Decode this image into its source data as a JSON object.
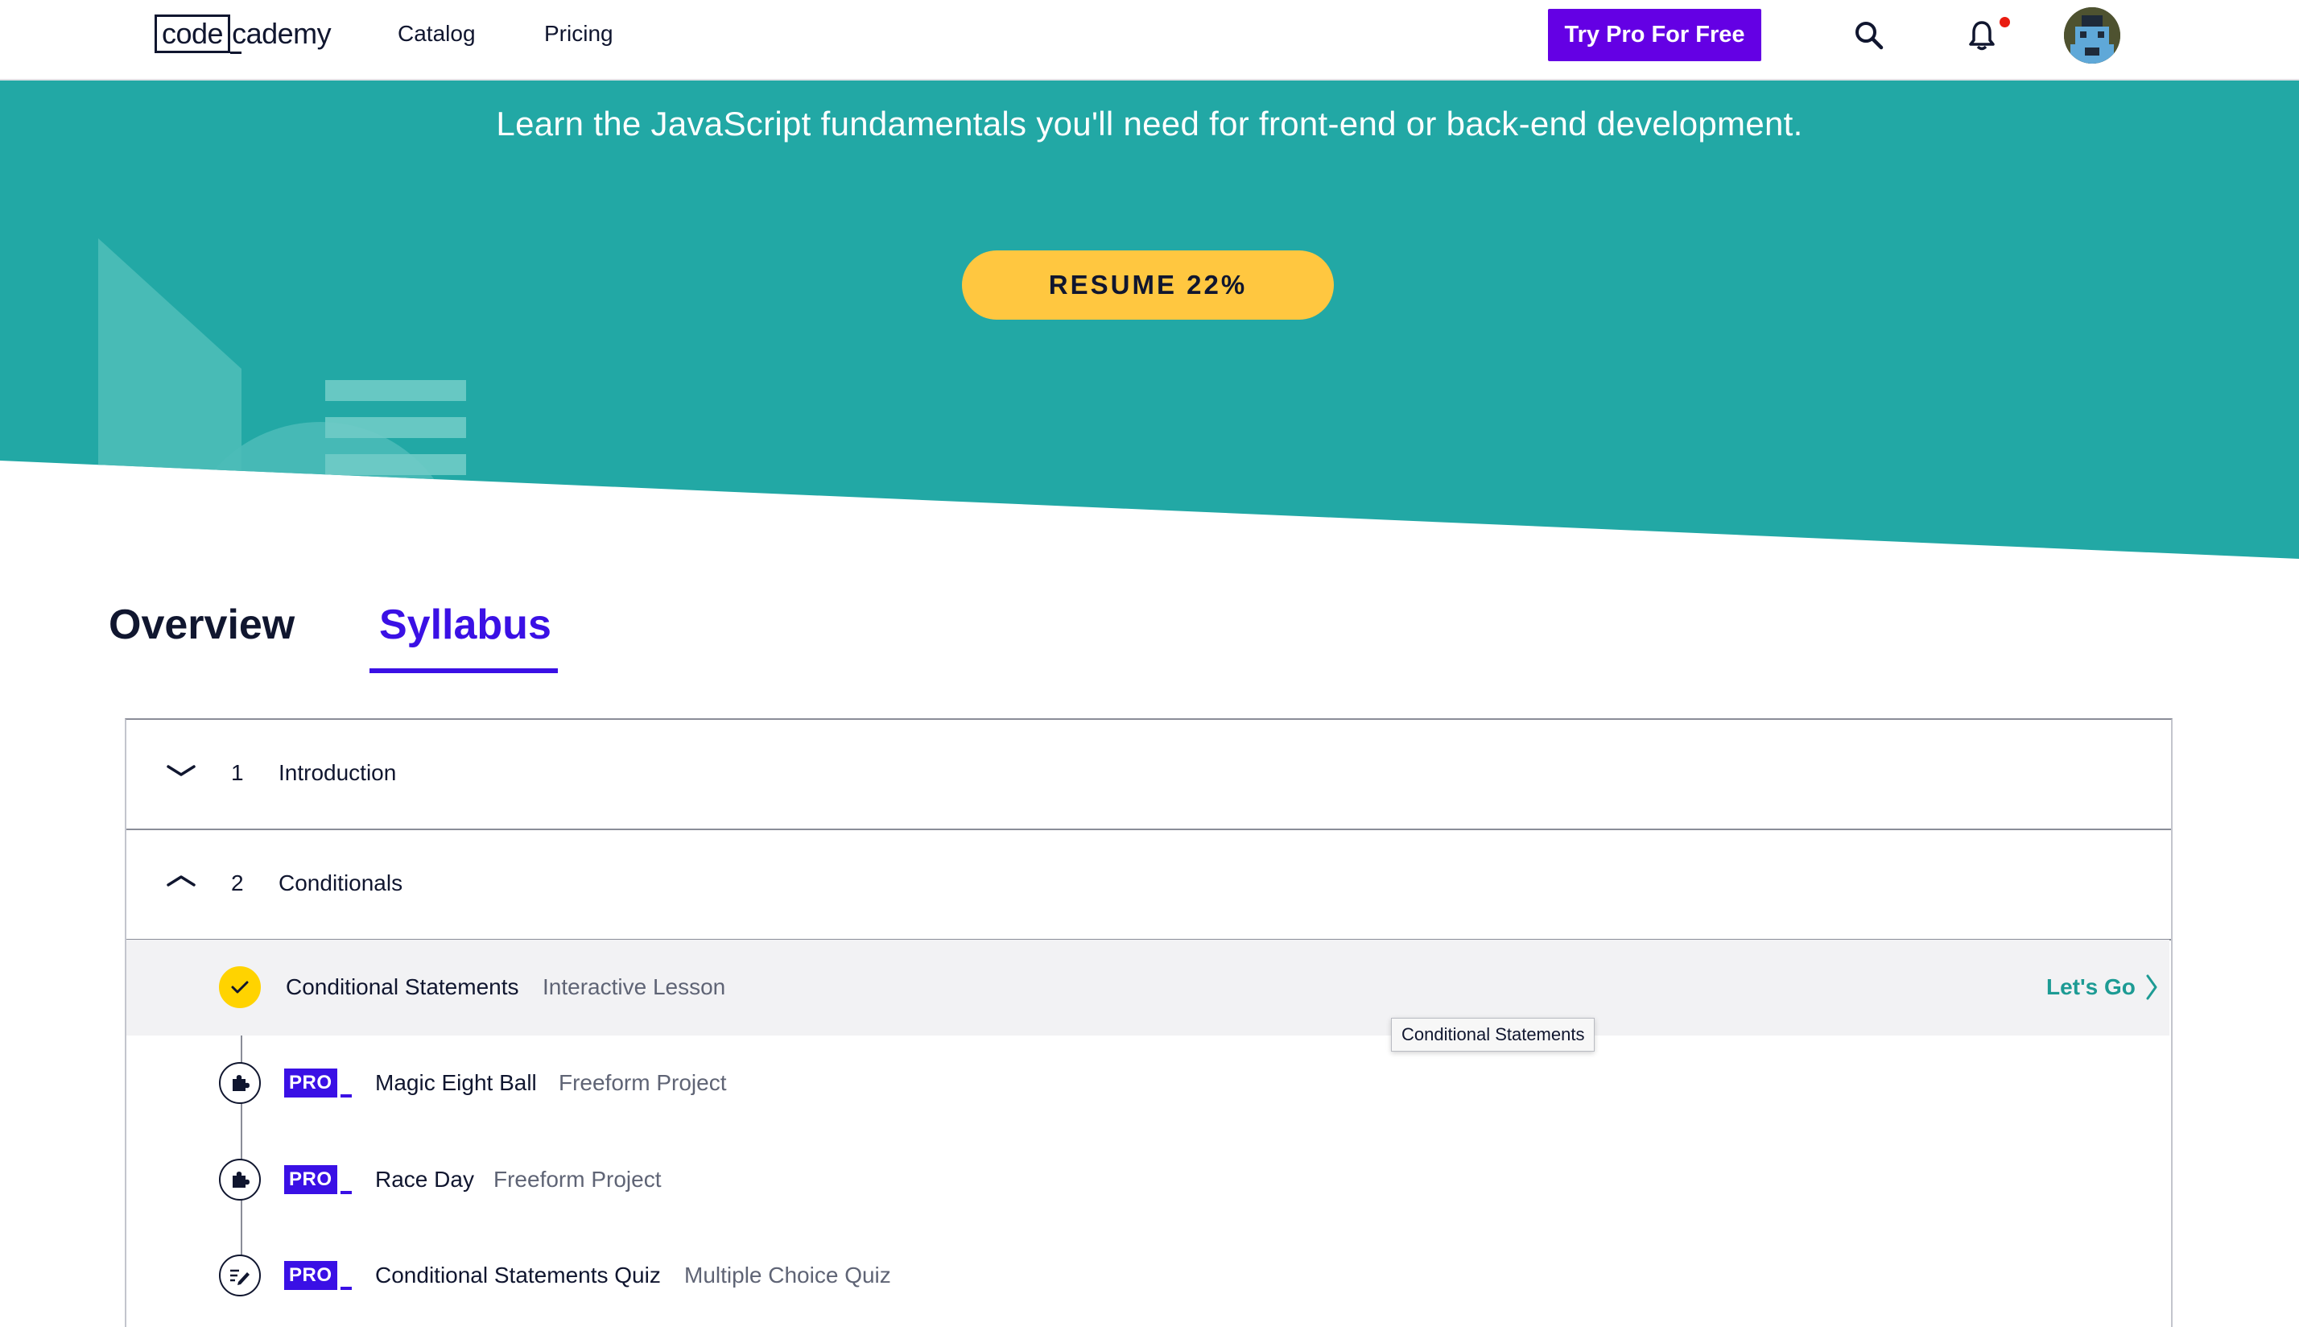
{
  "header": {
    "logo_box": "code",
    "logo_rest": "cademy",
    "nav": [
      {
        "label": "Catalog"
      },
      {
        "label": "Pricing"
      }
    ],
    "cta_label": "Try Pro For Free",
    "icons": [
      "search-icon",
      "bell-icon",
      "avatar"
    ],
    "notification_dot": true
  },
  "hero": {
    "subtitle": "Learn the JavaScript fundamentals you'll need for front-end or back-end development.",
    "resume_label": "RESUME 22%",
    "progress_percent": 22,
    "bg_color": "#22a8a5",
    "button_color": "#ffc740"
  },
  "tabs": [
    {
      "label": "Overview",
      "active": false
    },
    {
      "label": "Syllabus",
      "active": true
    }
  ],
  "syllabus": {
    "modules": [
      {
        "number": "1",
        "title": "Introduction",
        "expanded": false
      },
      {
        "number": "2",
        "title": "Conditionals",
        "expanded": true
      }
    ],
    "lessons": [
      {
        "name": "Conditional Statements",
        "type": "Interactive Lesson",
        "pro": false,
        "status": "completed",
        "icon": "check-icon"
      },
      {
        "name": "Magic Eight Ball",
        "type": "Freeform Project",
        "pro": true,
        "pro_label": "PRO",
        "icon": "puzzle-icon"
      },
      {
        "name": "Race Day",
        "type": "Freeform Project",
        "pro": true,
        "pro_label": "PRO",
        "icon": "puzzle-icon"
      },
      {
        "name": "Conditional Statements Quiz",
        "type": "Multiple Choice Quiz",
        "pro": true,
        "pro_label": "PRO",
        "icon": "quiz-icon"
      }
    ],
    "lets_go_label": "Let's Go",
    "tooltip": "Conditional Statements"
  },
  "colors": {
    "accent_purple": "#3a10e5",
    "cta_purple": "#6400e4",
    "teal_link": "#1d9b94",
    "check_yellow": "#ffd300"
  }
}
